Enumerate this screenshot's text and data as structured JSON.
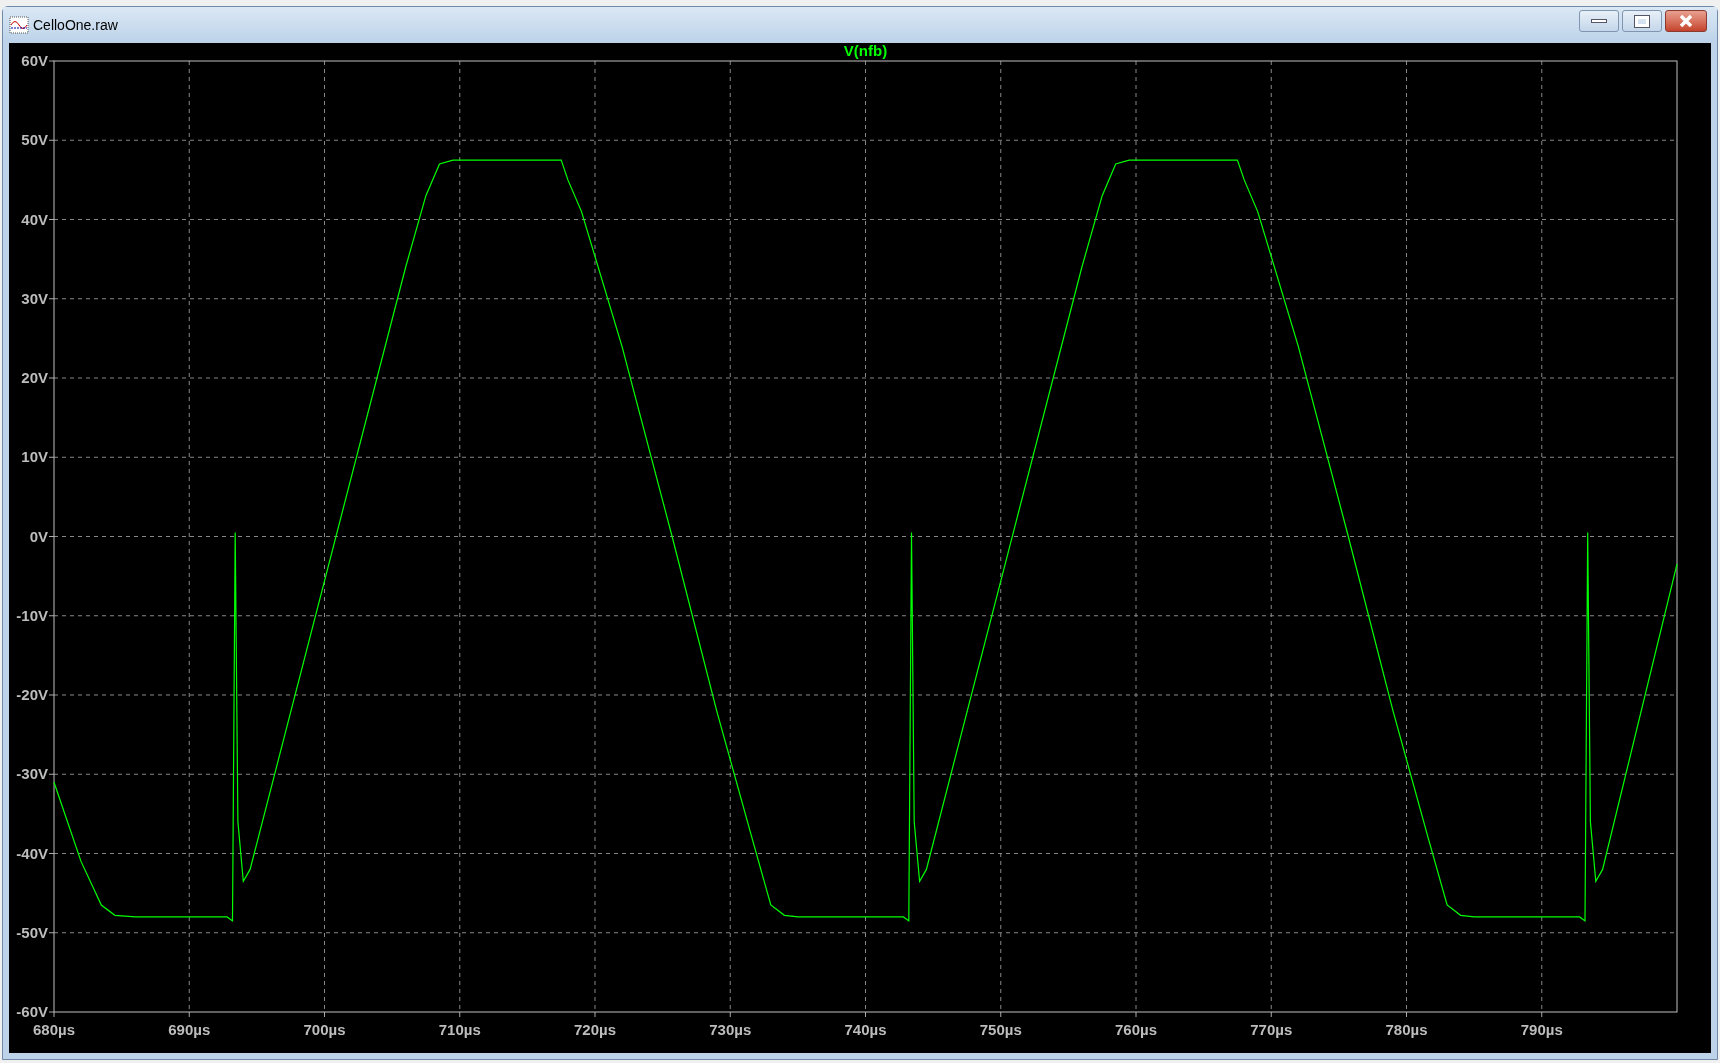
{
  "window": {
    "title": "CelloOne.raw"
  },
  "plot": {
    "chart_data": {
      "type": "line",
      "grid": true,
      "x": [
        680,
        682,
        683.5,
        684.5,
        686,
        692.8,
        693.2,
        693.4,
        693.6,
        694,
        694.5,
        701,
        706,
        707.5,
        708.5,
        709.5,
        717.5,
        718,
        719,
        722,
        725.7,
        729,
        731.6,
        733,
        734,
        735,
        742.8,
        743.2,
        743.4,
        743.6,
        744,
        744.5,
        751,
        756,
        757.5,
        758.5,
        759.5,
        767.5,
        768,
        769,
        772,
        775.7,
        779,
        781.6,
        783,
        784,
        785,
        792.8,
        793.2,
        793.4,
        793.6,
        794,
        794.5,
        800
      ],
      "series": [
        {
          "name": "V(nfb)",
          "color": "#00ff00",
          "values": [
            -31,
            -41,
            -46.5,
            -47.8,
            -48,
            -48,
            -48.5,
            0.5,
            -36,
            -43.5,
            -42,
            1,
            34,
            43,
            47,
            47.5,
            47.5,
            45,
            41,
            24,
            0,
            -22,
            -38,
            -46.5,
            -47.8,
            -48,
            -48,
            -48.5,
            0.5,
            -36,
            -43.5,
            -42,
            1,
            34,
            43,
            47,
            47.5,
            47.5,
            45,
            41,
            24,
            0,
            -22,
            -38,
            -46.5,
            -47.8,
            -48,
            -48,
            -48.5,
            0.5,
            -36,
            -43.5,
            -42,
            -3.5
          ]
        }
      ],
      "xlim": [
        680,
        800
      ],
      "ylim": [
        -60,
        60
      ],
      "xticks": [
        {
          "value": 680,
          "label": "680µs"
        },
        {
          "value": 690,
          "label": "690µs"
        },
        {
          "value": 700,
          "label": "700µs"
        },
        {
          "value": 710,
          "label": "710µs"
        },
        {
          "value": 720,
          "label": "720µs"
        },
        {
          "value": 730,
          "label": "730µs"
        },
        {
          "value": 740,
          "label": "740µs"
        },
        {
          "value": 750,
          "label": "750µs"
        },
        {
          "value": 760,
          "label": "760µs"
        },
        {
          "value": 770,
          "label": "770µs"
        },
        {
          "value": 780,
          "label": "780µs"
        },
        {
          "value": 790,
          "label": "790µs"
        }
      ],
      "yticks": [
        {
          "value": 60,
          "label": "60V"
        },
        {
          "value": 50,
          "label": "50V"
        },
        {
          "value": 40,
          "label": "40V"
        },
        {
          "value": 30,
          "label": "30V"
        },
        {
          "value": 20,
          "label": "20V"
        },
        {
          "value": 10,
          "label": "10V"
        },
        {
          "value": 0,
          "label": "0V"
        },
        {
          "value": -10,
          "label": "-10V"
        },
        {
          "value": -20,
          "label": "-20V"
        },
        {
          "value": -30,
          "label": "-30V"
        },
        {
          "value": -40,
          "label": "-40V"
        },
        {
          "value": -50,
          "label": "-50V"
        },
        {
          "value": -60,
          "label": "-60V"
        }
      ]
    }
  }
}
